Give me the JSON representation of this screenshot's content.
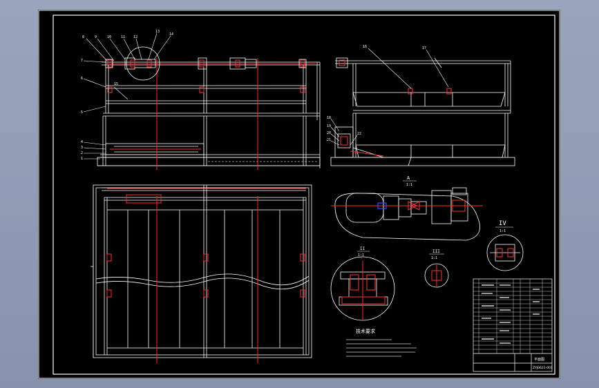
{
  "drawing": {
    "section_labels": {
      "a": "A",
      "a_scale": "1:1",
      "ii": "II",
      "ii_scale": "1:1",
      "iii": "III",
      "iii_scale": "1:1",
      "iv": "IV",
      "iv_scale": "1:1"
    },
    "tech_req_title": "技术要求",
    "callouts_left": [
      "8",
      "9",
      "10",
      "11",
      "12",
      "13",
      "14",
      "7",
      "6",
      "15",
      "5",
      "4",
      "3",
      "2",
      "1"
    ],
    "callouts_right": [
      "16",
      "17",
      "18",
      "19",
      "20",
      "21",
      "22"
    ]
  },
  "title_block": {
    "drawing_name": "平面图",
    "drawing_code": "ZYJ0621-001"
  },
  "colors": {
    "sheet": "#000000",
    "line": "#ffffff",
    "center": "#ff2a2a",
    "dim": "#ff5a5a",
    "highlight": "#2040ff"
  }
}
